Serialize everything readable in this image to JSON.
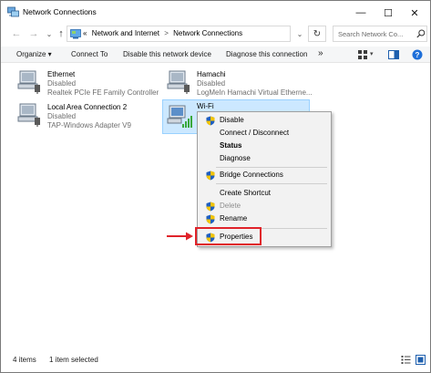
{
  "window": {
    "title": "Network Connections",
    "minimize_symbol": "—",
    "maximize_symbol": "☐",
    "close_symbol": "✕"
  },
  "nav": {
    "back_symbol": "←",
    "forward_symbol": "→",
    "recent_symbol": "⌄",
    "up_symbol": "↑",
    "breadcrumb": [
      "Network and Internet",
      "Network Connections"
    ],
    "overflow_symbol": "«",
    "separator": ">",
    "dropdown_symbol": "⌄",
    "refresh_symbol": "↻",
    "search_placeholder": "Search Network Co..."
  },
  "toolbar": {
    "organize": "Organize ▾",
    "connect_to": "Connect To",
    "disable": "Disable this network device",
    "diagnose": "Diagnose this connection",
    "more": "»",
    "view_dropdown_symbol": "▾"
  },
  "connections": [
    {
      "name": "Ethernet",
      "status": "Disabled",
      "adapter": "Realtek PCIe FE Family Controller"
    },
    {
      "name": "Hamachi",
      "status": "Disabled",
      "adapter": "LogMeIn Hamachi Virtual Etherne..."
    },
    {
      "name": "Local Area Connection 2",
      "status": "Disabled",
      "adapter": "TAP-Windows Adapter V9"
    },
    {
      "name": "Wi-Fi",
      "status": "",
      "adapter": ""
    }
  ],
  "context_menu": {
    "items": [
      {
        "label": "Disable",
        "shield": true
      },
      {
        "label": "Connect / Disconnect",
        "shield": false
      },
      {
        "label": "Status",
        "shield": false,
        "bold": true
      },
      {
        "label": "Diagnose",
        "shield": false
      },
      {
        "label": "Bridge Connections",
        "shield": true
      },
      {
        "label": "Create Shortcut",
        "shield": false
      },
      {
        "label": "Delete",
        "shield": true,
        "disabled": true
      },
      {
        "label": "Rename",
        "shield": true
      },
      {
        "label": "Properties",
        "shield": true
      }
    ]
  },
  "statusbar": {
    "item_count": "4 items",
    "selection": "1 item selected"
  },
  "colors": {
    "selection_bg": "#cce8ff",
    "selection_border": "#99d1ff",
    "highlight_red": "#e0232a",
    "shield_blue": "#1f5fbf",
    "shield_yellow": "#f5c400"
  }
}
